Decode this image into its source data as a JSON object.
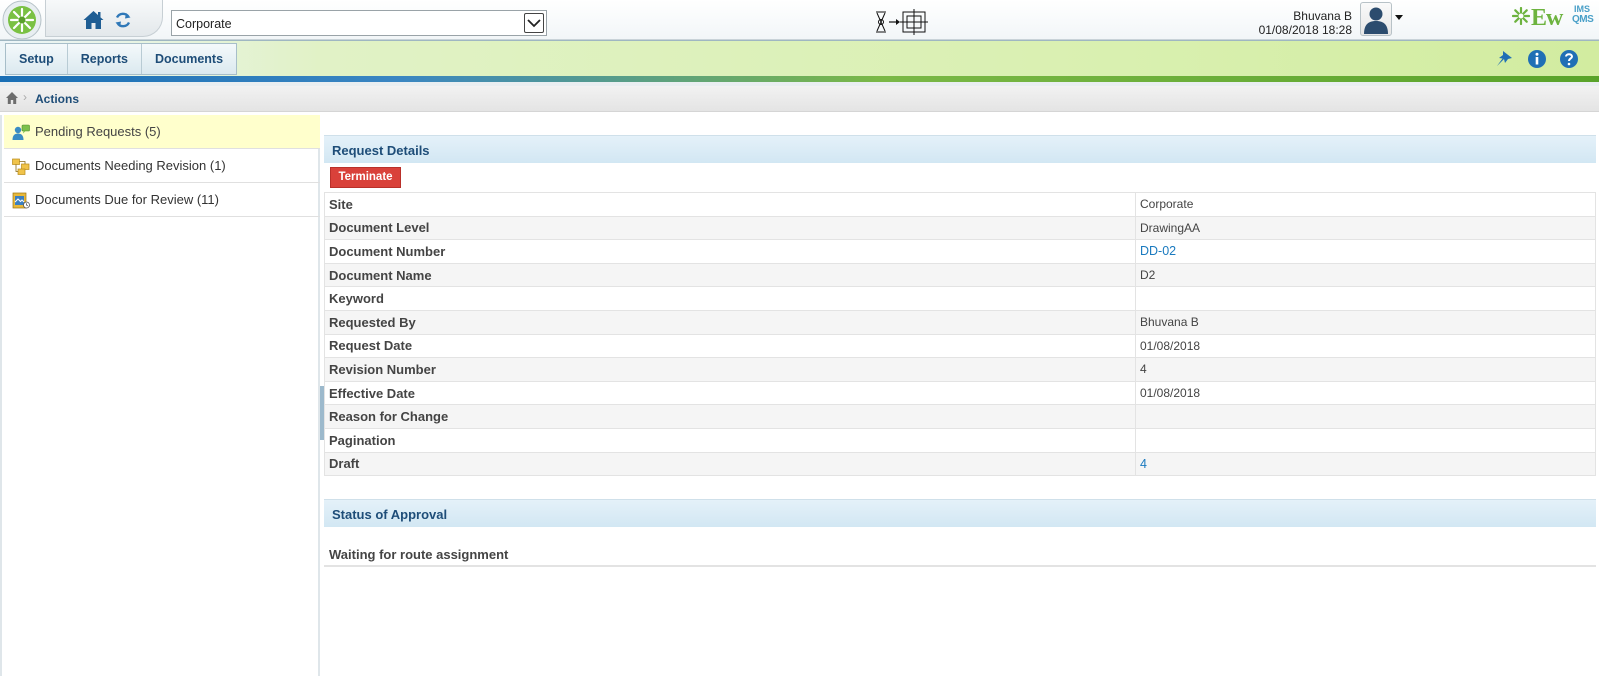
{
  "header": {
    "site_selected": "Corporate",
    "user_name": "Bhuvana B",
    "datetime": "01/08/2018 18:28",
    "brand": {
      "ew": "Ew",
      "ims": "IMS",
      "qms": "QMS"
    }
  },
  "menu": {
    "items": [
      "Setup",
      "Reports",
      "Documents"
    ],
    "icons": [
      "pin-icon",
      "info-icon",
      "help-icon"
    ]
  },
  "breadcrumb": {
    "current": "Actions"
  },
  "sidebar": {
    "items": [
      {
        "label": "Pending Requests (5)",
        "icon": "pending-requests-icon",
        "active": true
      },
      {
        "label": "Documents Needing Revision (1)",
        "icon": "documents-revision-icon",
        "active": false
      },
      {
        "label": "Documents Due for Review (11)",
        "icon": "documents-review-icon",
        "active": false
      }
    ]
  },
  "request_details": {
    "title": "Request Details",
    "terminate_label": "Terminate",
    "rows": [
      {
        "key": "Site",
        "value": "Corporate",
        "link": false
      },
      {
        "key": "Document Level",
        "value": "DrawingAA",
        "link": false
      },
      {
        "key": "Document Number",
        "value": "DD-02",
        "link": true
      },
      {
        "key": "Document Name",
        "value": "D2",
        "link": false
      },
      {
        "key": "Keyword",
        "value": "",
        "link": false
      },
      {
        "key": "Requested By",
        "value": "Bhuvana B",
        "link": false
      },
      {
        "key": "Request Date",
        "value": "01/08/2018",
        "link": false
      },
      {
        "key": "Revision Number",
        "value": "4",
        "link": false
      },
      {
        "key": "Effective Date",
        "value": "01/08/2018",
        "link": false
      },
      {
        "key": "Reason for Change",
        "value": "",
        "link": false
      },
      {
        "key": "Pagination",
        "value": "",
        "link": false
      },
      {
        "key": "Draft",
        "value": "4",
        "link": true
      }
    ]
  },
  "status_of_approval": {
    "title": "Status of Approval",
    "text": "Waiting for route assignment"
  },
  "colors": {
    "accent_blue": "#1e4d78",
    "link": "#1a7abf",
    "terminate": "#d9413a",
    "brand_green": "#6db33f",
    "active_row": "#ffffcc"
  }
}
